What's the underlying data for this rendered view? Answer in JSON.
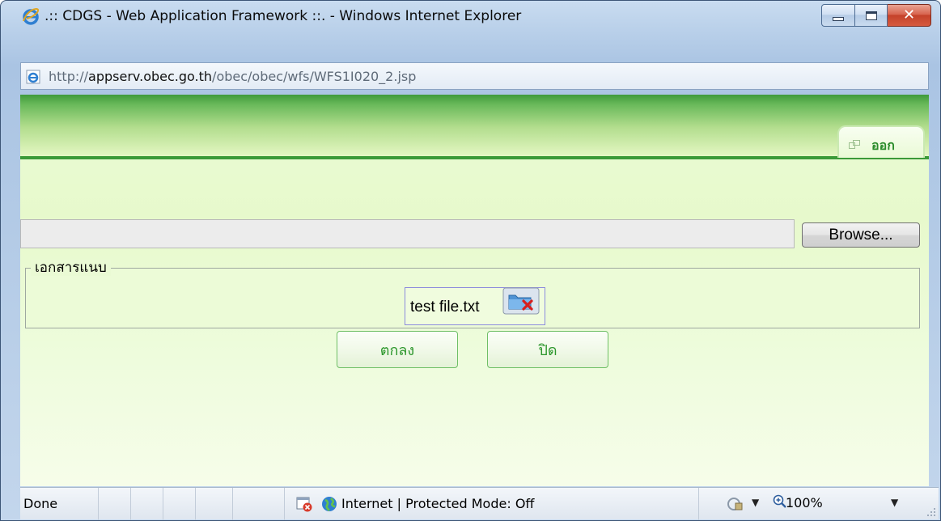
{
  "window": {
    "title": ".:: CDGS - Web Application Framework ::. - Windows Internet Explorer",
    "controls": {
      "minimize": "minimize",
      "maximize": "maximize",
      "close": "✕"
    }
  },
  "address": {
    "protocol": "http://",
    "host": "appserv.obec.go.th",
    "path": "/obec/obec/wfs/WFS1I020_2.jsp"
  },
  "header": {
    "logout_label": "ออก"
  },
  "upload": {
    "file_value": "",
    "browse_label": "Browse..."
  },
  "attachments": {
    "legend": "เอกสารแนบ",
    "files": [
      {
        "name": "test file.txt"
      }
    ]
  },
  "actions": {
    "ok_label": "ตกลง",
    "close_label": "ปิด"
  },
  "status": {
    "done": "Done",
    "zone": "Internet | Protected Mode: Off",
    "zoom": "100%"
  },
  "icons": {
    "browser": "ie-logo-icon",
    "page": "ie-page-icon",
    "logout": "logout-icon",
    "delete": "folder-delete-icon",
    "zone_error": "zone-error-icon",
    "globe": "globe-icon",
    "protected_mode": "protected-mode-icon",
    "zoom": "zoom-icon"
  },
  "colors": {
    "accent_green": "#3b9a38",
    "button_text": "#2b962b",
    "content_bg": "#e7f9cc"
  }
}
